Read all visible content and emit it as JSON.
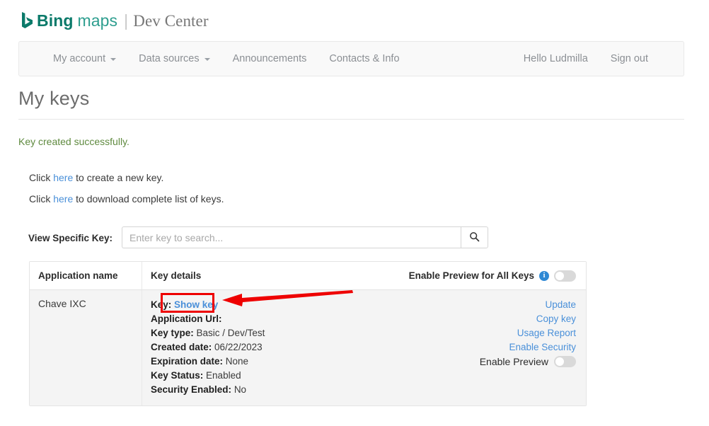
{
  "brand": {
    "logo_icon": "bing-logo-icon",
    "bing": "Bing",
    "maps": "maps",
    "separator": "|",
    "dev_center": "Dev Center"
  },
  "nav": {
    "left_items": [
      {
        "label": "My account",
        "has_caret": true
      },
      {
        "label": "Data sources",
        "has_caret": true
      },
      {
        "label": "Announcements",
        "has_caret": false
      },
      {
        "label": "Contacts & Info",
        "has_caret": false
      }
    ],
    "right_items": [
      {
        "label": "Hello Ludmilla"
      },
      {
        "label": "Sign out"
      }
    ]
  },
  "page": {
    "title": "My keys",
    "status_message": "Key created successfully.",
    "status_color": "#5f8a3f"
  },
  "actions_text": {
    "create_prefix": "Click ",
    "create_link": "here",
    "create_suffix": " to create a new key.",
    "download_prefix": "Click ",
    "download_link": "here",
    "download_suffix": " to download complete list of keys."
  },
  "search": {
    "label": "View Specific Key:",
    "value": "",
    "placeholder": "Enter key to search...",
    "button_icon": "search-icon"
  },
  "table": {
    "headers": {
      "application_name": "Application name",
      "key_details": "Key details",
      "enable_preview_all": "Enable Preview for All Keys",
      "info_icon": "info-icon",
      "preview_all_toggle_state": "off"
    },
    "rows": [
      {
        "application_name": "Chave IXC",
        "details": [
          {
            "label": "Key:",
            "value": "Show key",
            "value_is_link": true
          },
          {
            "label": "Application Url:",
            "value": ""
          },
          {
            "label": "Key type:",
            "value": "Basic / Dev/Test"
          },
          {
            "label": "Created date:",
            "value": "06/22/2023"
          },
          {
            "label": "Expiration date:",
            "value": "None"
          },
          {
            "label": "Key Status:",
            "value": "Enabled"
          },
          {
            "label": "Security Enabled:",
            "value": "No"
          }
        ],
        "actions": [
          "Update",
          "Copy key",
          "Usage Report",
          "Enable Security"
        ],
        "preview_label": "Enable Preview",
        "preview_toggle_state": "off"
      }
    ]
  },
  "annotations": {
    "highlight_color": "#ee0000",
    "highlight_target": "Show key",
    "arrow_direction": "left"
  },
  "colors": {
    "link": "#4a90d9",
    "brand_teal": "#0b7a6a",
    "brand_teal_light": "#2e9e8f",
    "info_blue": "#2f89d4"
  }
}
